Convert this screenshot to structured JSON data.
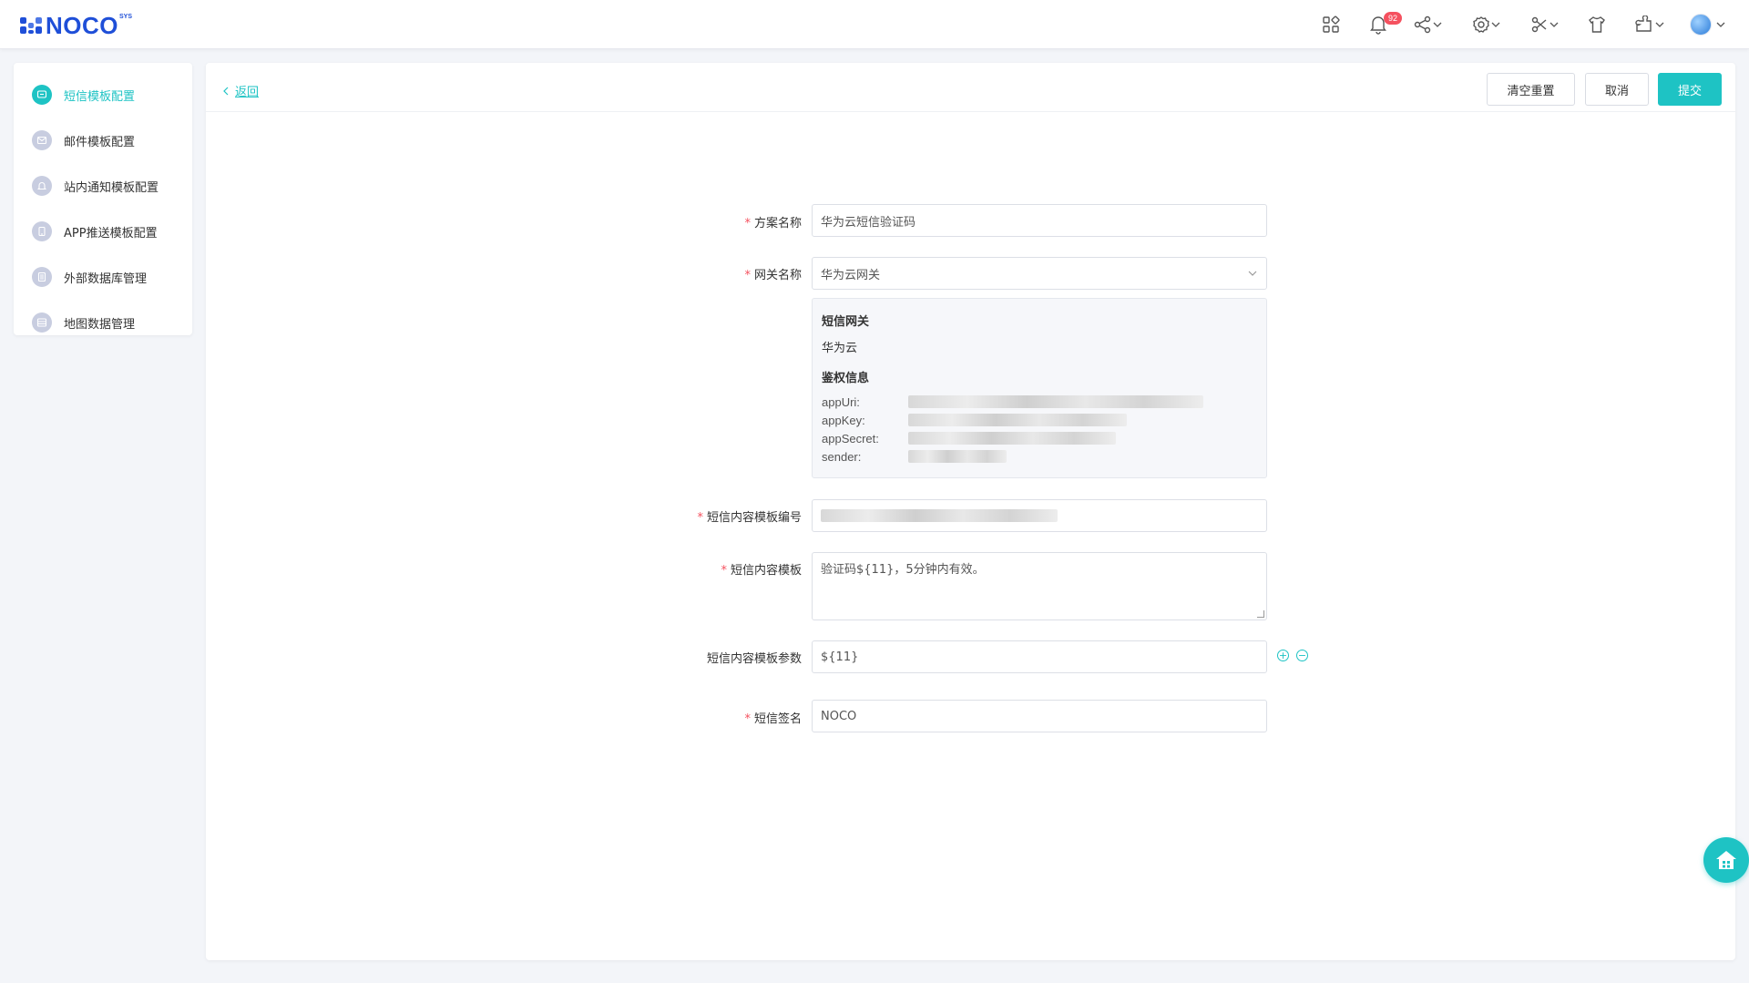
{
  "header": {
    "logo_text": "NOCO",
    "logo_sup": "SYS",
    "notification_count": "92"
  },
  "sidebar": {
    "items": [
      {
        "label": "短信模板配置",
        "active": true
      },
      {
        "label": "邮件模板配置"
      },
      {
        "label": "站内通知模板配置"
      },
      {
        "label": "APP推送模板配置"
      },
      {
        "label": "外部数据库管理"
      },
      {
        "label": "地图数据管理"
      }
    ]
  },
  "toolbar": {
    "back_label": "返回",
    "reset_label": "清空重置",
    "cancel_label": "取消",
    "submit_label": "提交"
  },
  "form": {
    "scheme_name_label": "方案名称",
    "scheme_name_value": "华为云短信验证码",
    "gateway_label": "网关名称",
    "gateway_value": "华为云网关",
    "gateway_info": {
      "sms_gateway_title": "短信网关",
      "sms_gateway_value": "华为云",
      "auth_title": "鉴权信息",
      "keys": [
        "appUri:",
        "appKey:",
        "appSecret:",
        "sender:"
      ]
    },
    "template_id_label": "短信内容模板编号",
    "template_label": "短信内容模板",
    "template_value": "验证码${11}，5分钟内有效。",
    "template_params_label": "短信内容模板参数",
    "template_params_value": "${11}",
    "signature_label": "短信签名",
    "signature_value": "NOCO"
  },
  "colors": {
    "accent": "#1ec3c4",
    "brand": "#1f4fd8",
    "required": "#f5515f"
  }
}
